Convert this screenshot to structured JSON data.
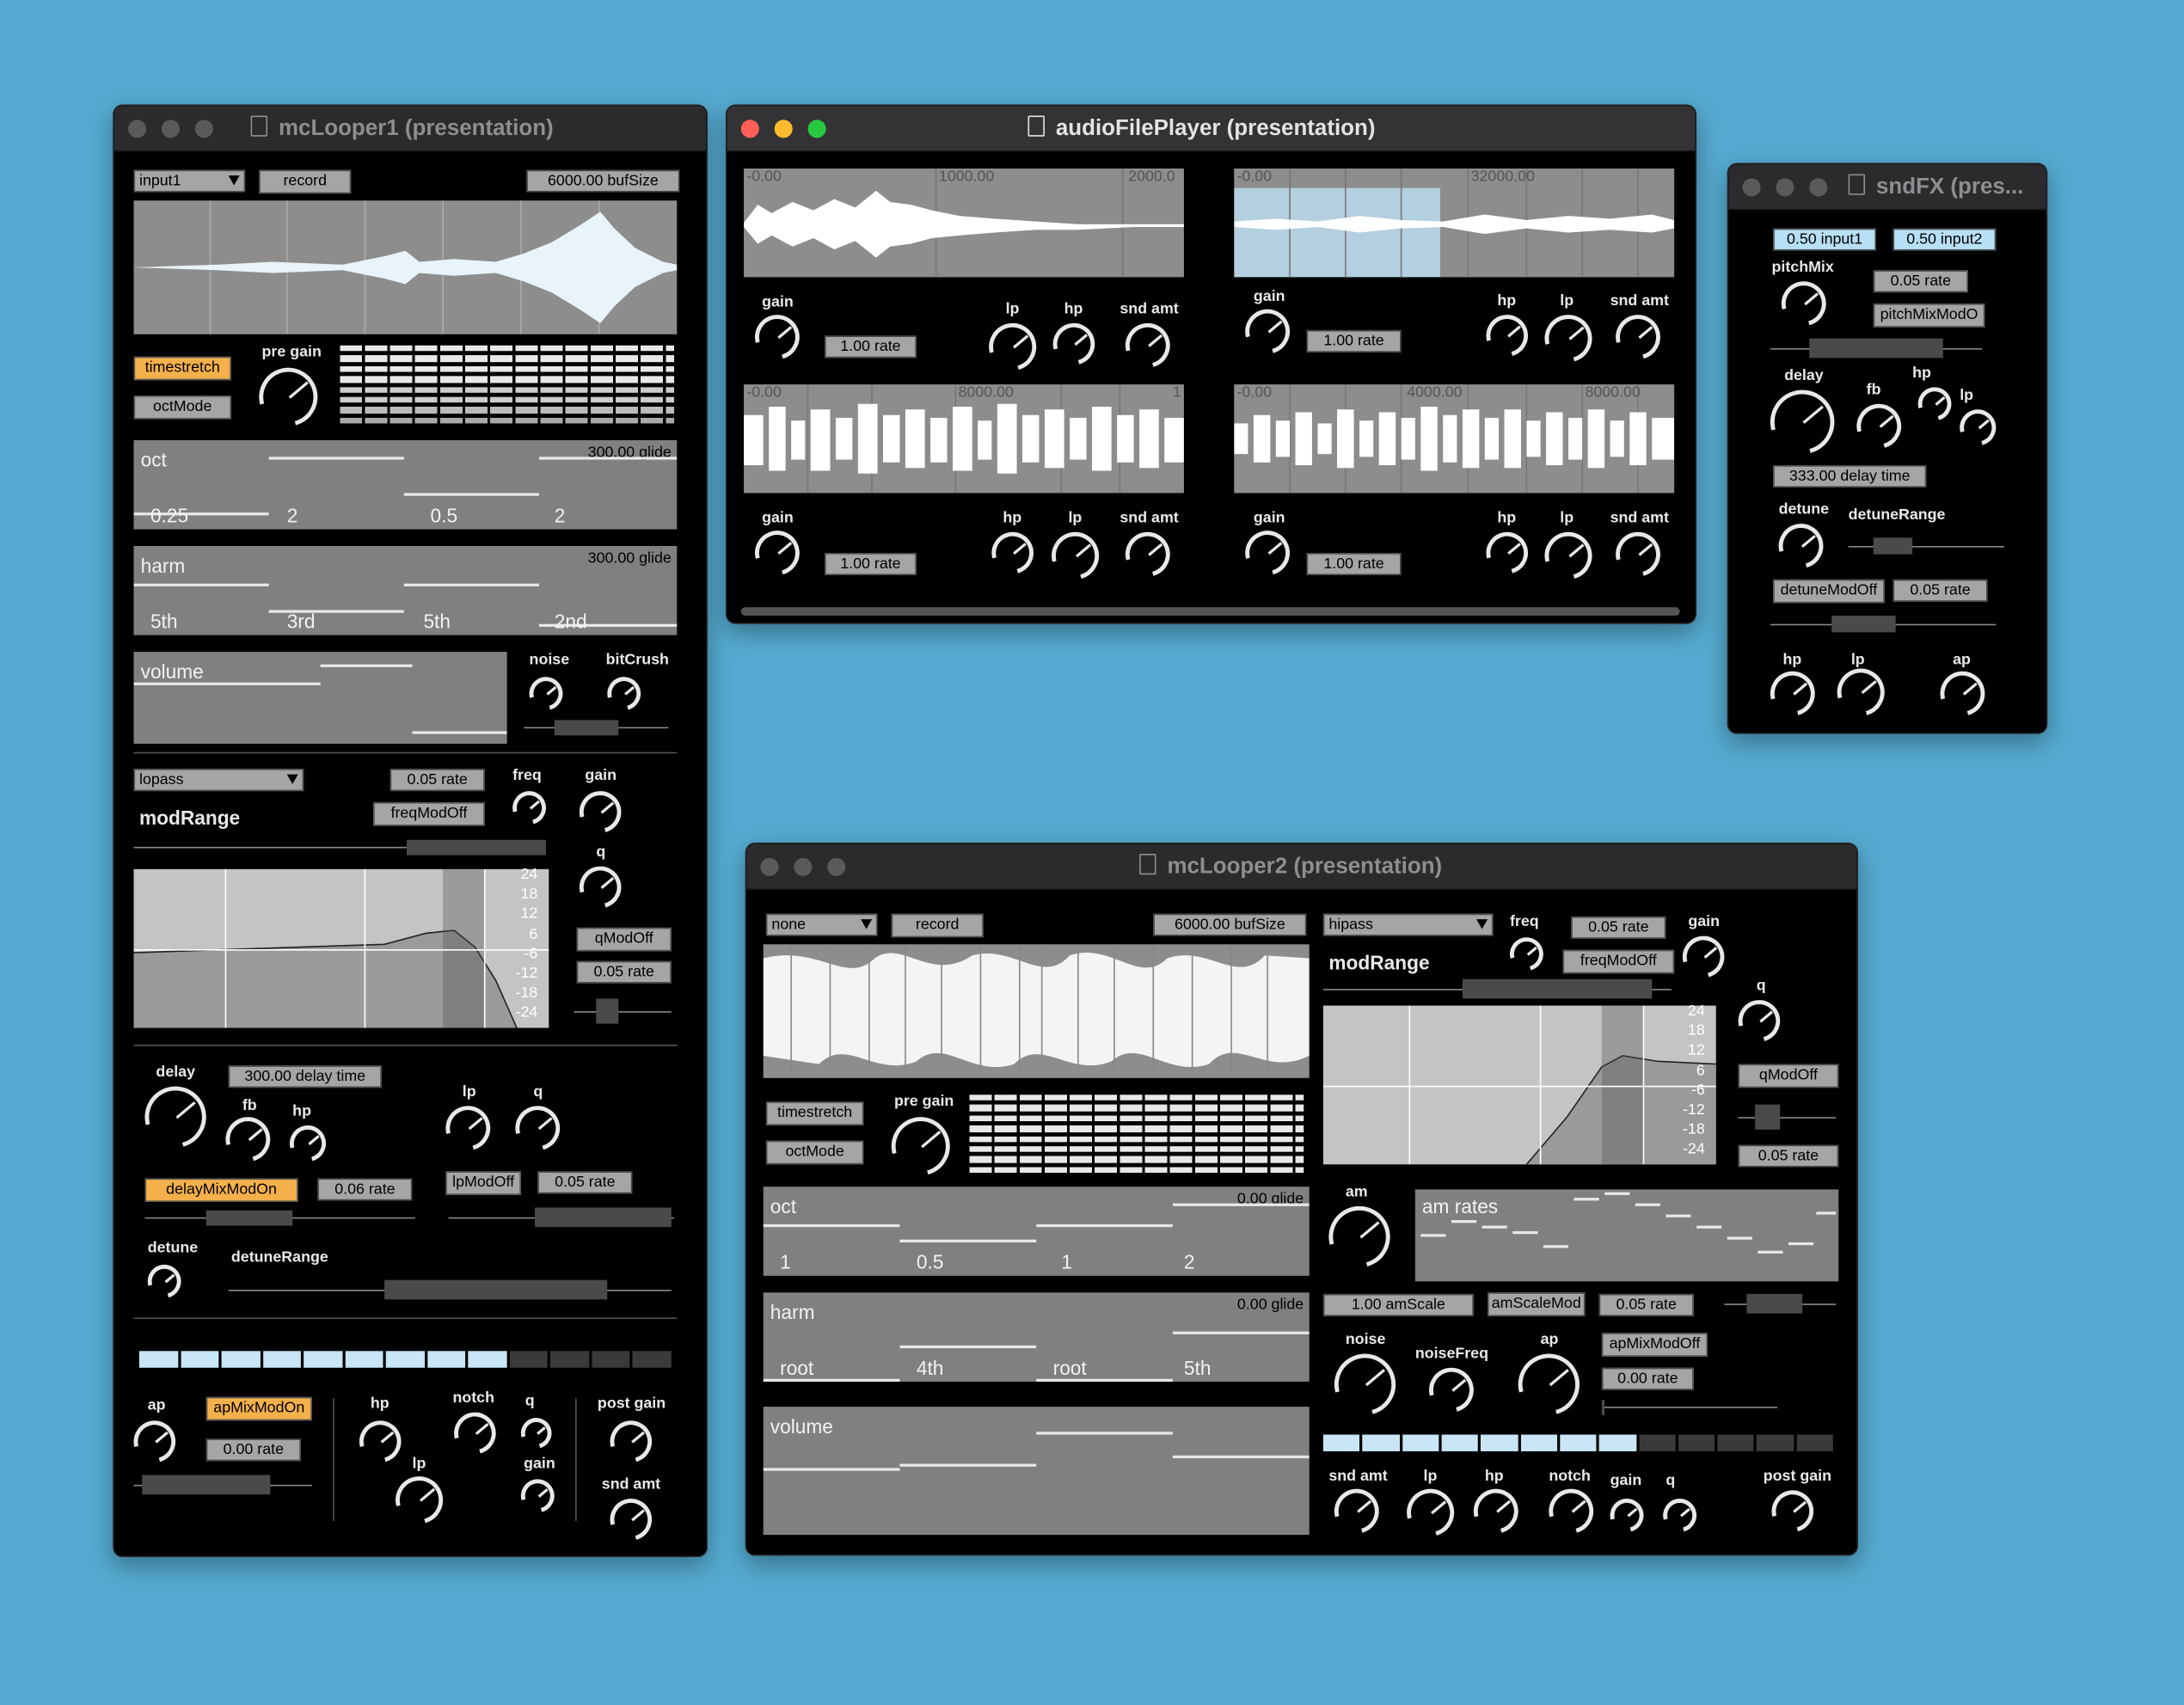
{
  "w1": {
    "title": "mcLooper1 (presentation)",
    "input": "input1",
    "record": "record",
    "bufsize": "6000.00 bufSize",
    "timestretch": "timestretch",
    "octmode": "octMode",
    "pregain": "pre gain",
    "oct": {
      "title": "oct",
      "glide": "300.00 glide",
      "labels": [
        "0.25",
        "2",
        "0.5",
        "2"
      ]
    },
    "harm": {
      "title": "harm",
      "glide": "300.00 glide",
      "labels": [
        "5th",
        "3rd",
        "5th",
        "2nd"
      ]
    },
    "volume": "volume",
    "noise": "noise",
    "bitcrush": "bitCrush",
    "filter": "lopass",
    "rate1": "0.05 rate",
    "freq": "freq",
    "gain": "gain",
    "modrange": "modRange",
    "freqmodoff": "freqModOff",
    "q": "q",
    "qmodoff": "qModOff",
    "rate2": "0.05 rate",
    "dbticks": [
      "24",
      "18",
      "12",
      "6",
      "-6",
      "-12",
      "-18",
      "-24"
    ],
    "delay": "delay",
    "delaytime": "300.00 delay time",
    "fb": "fb",
    "hp": "hp",
    "lp": "lp",
    "q2": "q",
    "delaymix": "delayMixModOn",
    "rate3": "0.06 rate",
    "lpmodoff": "lpModOff",
    "rate4": "0.05 rate",
    "detune": "detune",
    "detunerange": "detuneRange",
    "ap": "ap",
    "apmix": "apMixModOn",
    "rate5": "0.00 rate",
    "hp2": "hp",
    "notch": "notch",
    "q3": "q",
    "postgain": "post gain",
    "lp2": "lp",
    "gain2": "gain",
    "sndamt": "snd amt"
  },
  "w2": {
    "title": "audioFilePlayer (presentation)",
    "waves": [
      {
        "ticks": [
          "-0.00",
          "1000.00",
          "2000.0"
        ]
      },
      {
        "ticks": [
          "-0.00",
          "32000.00"
        ]
      },
      {
        "ticks": [
          "-0.00",
          "8000.00",
          "1"
        ]
      },
      {
        "ticks": [
          "-0.00",
          "4000.00",
          "8000.00"
        ]
      }
    ],
    "gain": "gain",
    "rate": "1.00 rate",
    "hp": "hp",
    "lp": "lp",
    "sndamt": "snd amt"
  },
  "w3": {
    "title": "sndFX (pres...",
    "input1": "0.50 input1",
    "input2": "0.50 input2",
    "pitchmix": "pitchMix",
    "rate1": "0.05 rate",
    "pitchmod": "pitchMixModO",
    "delay": "delay",
    "fb": "fb",
    "hp": "hp",
    "lp": "lp",
    "delaytime": "333.00 delay time",
    "detune": "detune",
    "detunerange": "detuneRange",
    "detunemod": "detuneModOff",
    "rate2": "0.05 rate",
    "hp2": "hp",
    "lp2": "lp",
    "ap": "ap"
  },
  "w4": {
    "title": "mcLooper2 (presentation)",
    "input": "none",
    "record": "record",
    "bufsize": "6000.00 bufSize",
    "filter": "hipass",
    "freq": "freq",
    "rate1": "0.05 rate",
    "gain": "gain",
    "modrange": "modRange",
    "freqmodoff": "freqModOff",
    "q": "q",
    "qmodoff": "qModOff",
    "rate2": "0.05 rate",
    "dbticks": [
      "24",
      "18",
      "12",
      "6",
      "-6",
      "-12",
      "-18",
      "-24"
    ],
    "timestretch": "timestretch",
    "octmode": "octMode",
    "pregain": "pre gain",
    "oct": {
      "title": "oct",
      "glide": "0.00 glide",
      "labels": [
        "1",
        "0.5",
        "1",
        "2"
      ]
    },
    "harm": {
      "title": "harm",
      "glide": "0.00 glide",
      "labels": [
        "root",
        "4th",
        "root",
        "5th"
      ]
    },
    "volume": "volume",
    "am": "am",
    "amrates": "am rates",
    "amscale": "1.00 amScale",
    "amscalemod": "amScaleMod",
    "rate3": "0.05 rate",
    "noise": "noise",
    "noisefreq": "noiseFreq",
    "ap": "ap",
    "apmix": "apMixModOff",
    "rate4": "0.00 rate",
    "sndamt": "snd amt",
    "lp": "lp",
    "hp": "hp",
    "notch": "notch",
    "gain2": "gain",
    "q2": "q",
    "postgain": "post gain"
  },
  "colors": {
    "desktop": "#55abd1",
    "active": "#f4b04a",
    "light": "#b7dff5"
  }
}
